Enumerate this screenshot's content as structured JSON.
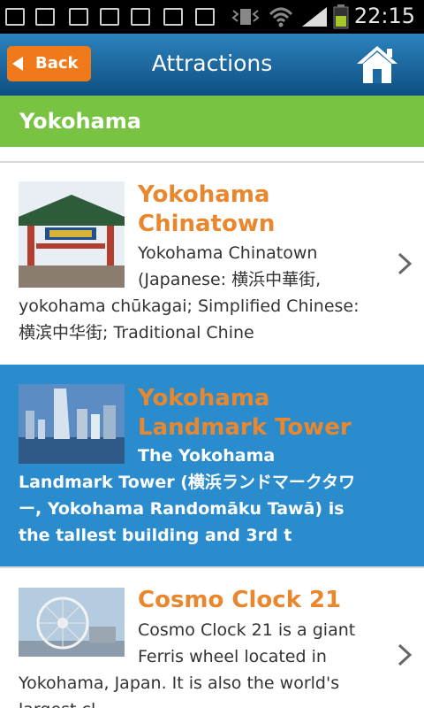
{
  "status_bar": {
    "time": "22:15",
    "left_icons": [
      "add-icon",
      "sd-card-icon",
      "terminal-icon",
      "image-icon",
      "play-icon",
      "play-icon",
      "play-icon"
    ],
    "right_icons": [
      "vibrate-icon",
      "wifi-icon",
      "signal-icon",
      "battery-icon"
    ]
  },
  "app_bar": {
    "back_label": "Back",
    "title": "Attractions",
    "home_icon": "home-icon",
    "colors": {
      "bar_top": "#2d83be",
      "bar_bottom": "#0d4f82",
      "back_button": "#f07a1a"
    }
  },
  "section": {
    "title": "Yokohama",
    "color": "#78c442"
  },
  "items": [
    {
      "title": "Yokohama Chinatown",
      "description": "Yokohama Chinatown (Japanese: 横浜中華街, yokohama chūkagai; Simplified Chinese: 横滨中华街; Traditional Chine",
      "selected": false
    },
    {
      "title": "Yokohama Landmark Tower",
      "description": "The Yokohama Landmark Tower (横浜ランドマークタワー, Yokohama Randomāku Tawā) is the tallest building and 3rd t",
      "selected": true
    },
    {
      "title": "Cosmo Clock 21",
      "description": "Cosmo Clock 21 is a giant Ferris wheel located in Yokohama, Japan. It is also the world's largest cl",
      "selected": false
    }
  ],
  "colors": {
    "item_title": "#e9872e",
    "selected_bg": "#2a8ccc"
  }
}
